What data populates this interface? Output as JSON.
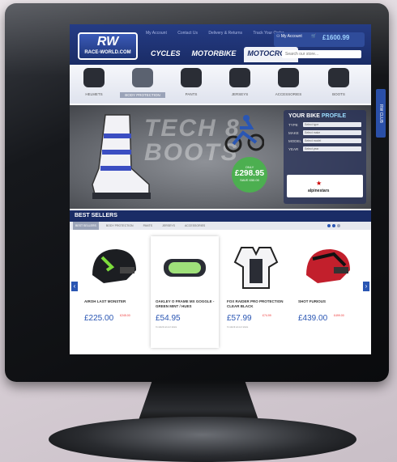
{
  "header": {
    "logo_mark": "RW",
    "logo_sub": "RACE-WORLD.COM",
    "top_links": [
      "My Account",
      "Contact Us",
      "Delivery & Returns",
      "Track Your Order"
    ],
    "categories": [
      "CYCLES",
      "MOTORBIKE",
      "MOTOCROSS"
    ],
    "active_category": "MOTOCROSS",
    "account_label": "My Account",
    "account_sub": "Login",
    "basket_total": "£1600.99",
    "search_placeholder": "Search our store..."
  },
  "subcategories": [
    {
      "label": "HELMETS",
      "icon": "helmet-icon"
    },
    {
      "label": "BODY PROTECTION",
      "icon": "body-armor-icon"
    },
    {
      "label": "PANTS",
      "icon": "pants-icon"
    },
    {
      "label": "JERSEYS",
      "icon": "jersey-icon"
    },
    {
      "label": "ACCESSORIES",
      "icon": "accessories-icon"
    },
    {
      "label": "BOOTS",
      "icon": "boots-icon"
    }
  ],
  "hero": {
    "headline_line1": "TECH 8",
    "headline_line2": "BOOTS",
    "price_label": "ONLY",
    "price": "£298.95",
    "price_sub": "SAVE £50.00"
  },
  "bike_profile": {
    "title_a": "YOUR BIKE",
    "title_b": "PROFILE",
    "fields": [
      {
        "key": "TYPE",
        "value": "Select type"
      },
      {
        "key": "MAKE",
        "value": "Select make"
      },
      {
        "key": "MODEL",
        "value": "Select model"
      },
      {
        "key": "YEAR",
        "value": "Select year"
      }
    ],
    "ad_brand": "alpinestars"
  },
  "best_sellers": {
    "title": "BEST SELLERS",
    "tabs": [
      "BEST SELLERS",
      "BODY PROTECTION",
      "PANTS",
      "JERSEYS",
      "ACCESSORIES"
    ],
    "products": [
      {
        "name": "AIROH LAST MONSTER",
        "price": "£225.00",
        "was": "£245.00",
        "stock": "",
        "icon": "helmet-icon"
      },
      {
        "name": "OAKLEY O FRAME MX GOGGLE - GREEN MINT / HUES",
        "price": "£54.95",
        "was": "",
        "stock": "In stock at our store",
        "icon": "goggles-icon"
      },
      {
        "name": "FOX RAIDER PRO PROTECTION CLEAR BLACK",
        "price": "£57.99",
        "was": "£74.99",
        "stock": "In stock at our store",
        "icon": "chest-protector-icon"
      },
      {
        "name": "SHOT FURIOUS",
        "price": "£439.00",
        "was": "£499.00",
        "stock": "",
        "icon": "helmet-icon"
      }
    ]
  },
  "side_tab": "RW CLUB",
  "colors": {
    "brand": "#1a2c66",
    "accent": "#2a56b3",
    "sale": "#4caf50"
  }
}
